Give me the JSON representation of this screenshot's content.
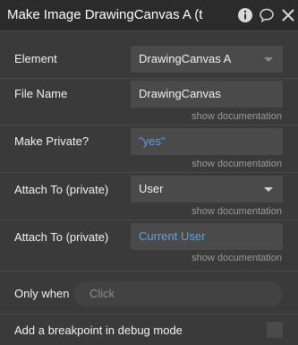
{
  "header": {
    "title": "Make Image DrawingCanvas A (t",
    "icons": [
      "info-icon",
      "comment-icon",
      "close-icon"
    ]
  },
  "fields": {
    "element": {
      "label": "Element",
      "value": "DrawingCanvas A"
    },
    "file_name": {
      "label": "File Name",
      "value": "DrawingCanvas",
      "doc": "show documentation"
    },
    "make_private": {
      "label": "Make Private?",
      "value": "\"yes\"",
      "doc": "show documentation"
    },
    "attach_to_1": {
      "label": "Attach To (private)",
      "value": "User",
      "doc": "show documentation"
    },
    "attach_to_2": {
      "label": "Attach To (private)",
      "value": "Current User",
      "doc": "show documentation"
    }
  },
  "only_when": {
    "label": "Only when",
    "placeholder": "Click"
  },
  "breakpoint": {
    "label": "Add a breakpoint in debug mode",
    "checked": false
  },
  "colors": {
    "background": "#3a3a3a",
    "field": "#4a4a4a",
    "dynamic_text": "#5aa0e8",
    "muted_text": "#9a9a9a"
  }
}
